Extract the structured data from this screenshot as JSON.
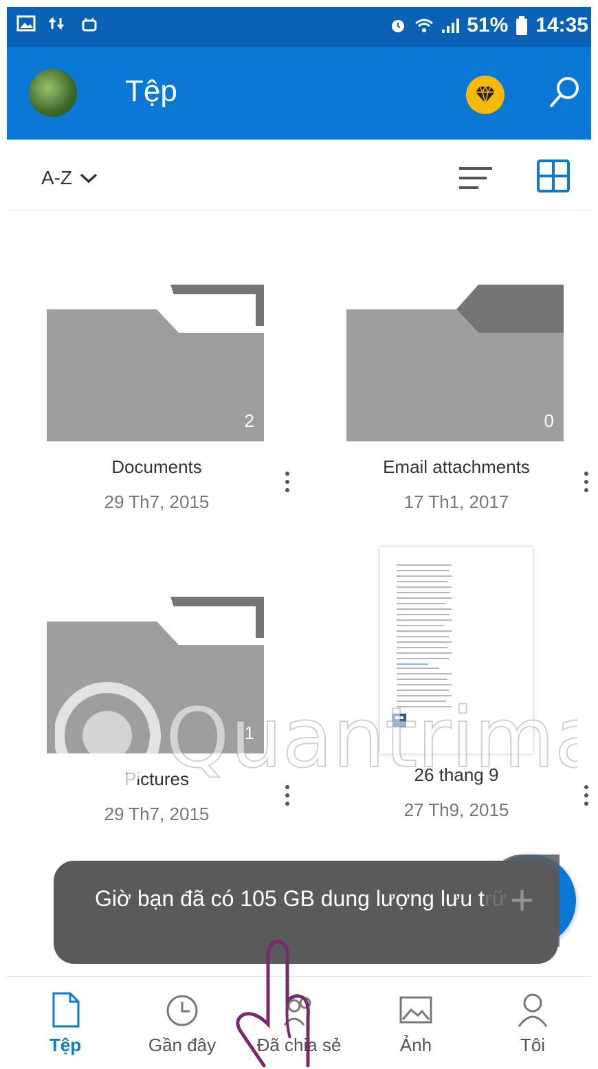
{
  "status_bar": {
    "icons": [
      "gallery-icon",
      "data-transfer-icon",
      "android-debug-icon",
      "alarm-icon",
      "wifi-icon",
      "signal-icon",
      "battery-icon"
    ],
    "battery": "51%",
    "time": "14:35"
  },
  "app_bar": {
    "title": "Tệp",
    "accent_color": "#0A78D4",
    "premium_color": "#F5B90A"
  },
  "sort_bar": {
    "sort_label": "A-Z"
  },
  "items": [
    {
      "name": "Documents",
      "date": "29 Th7, 2015",
      "count": "2",
      "type": "folder"
    },
    {
      "name": "Email attachments",
      "date": "17 Th1, 2017",
      "count": "0",
      "type": "folder"
    },
    {
      "name": "Pictures",
      "date": "29 Th7, 2015",
      "count": "1",
      "type": "folder"
    },
    {
      "name": "26 thang 9",
      "date": "27 Th9, 2015",
      "type": "document"
    }
  ],
  "toast": {
    "message": "Giờ bạn đã có 105 GB dung lượng lưu trữ"
  },
  "bottom_nav": [
    {
      "label": "Tệp",
      "icon": "file-icon",
      "active": true
    },
    {
      "label": "Gần đây",
      "icon": "clock-icon",
      "active": false
    },
    {
      "label": "Đã chia sẻ",
      "icon": "shared-people-icon",
      "active": false
    },
    {
      "label": "Ảnh",
      "icon": "photo-icon",
      "active": false
    },
    {
      "label": "Tôi",
      "icon": "person-icon",
      "active": false
    }
  ],
  "watermark": {
    "text": "Quantrimang"
  }
}
